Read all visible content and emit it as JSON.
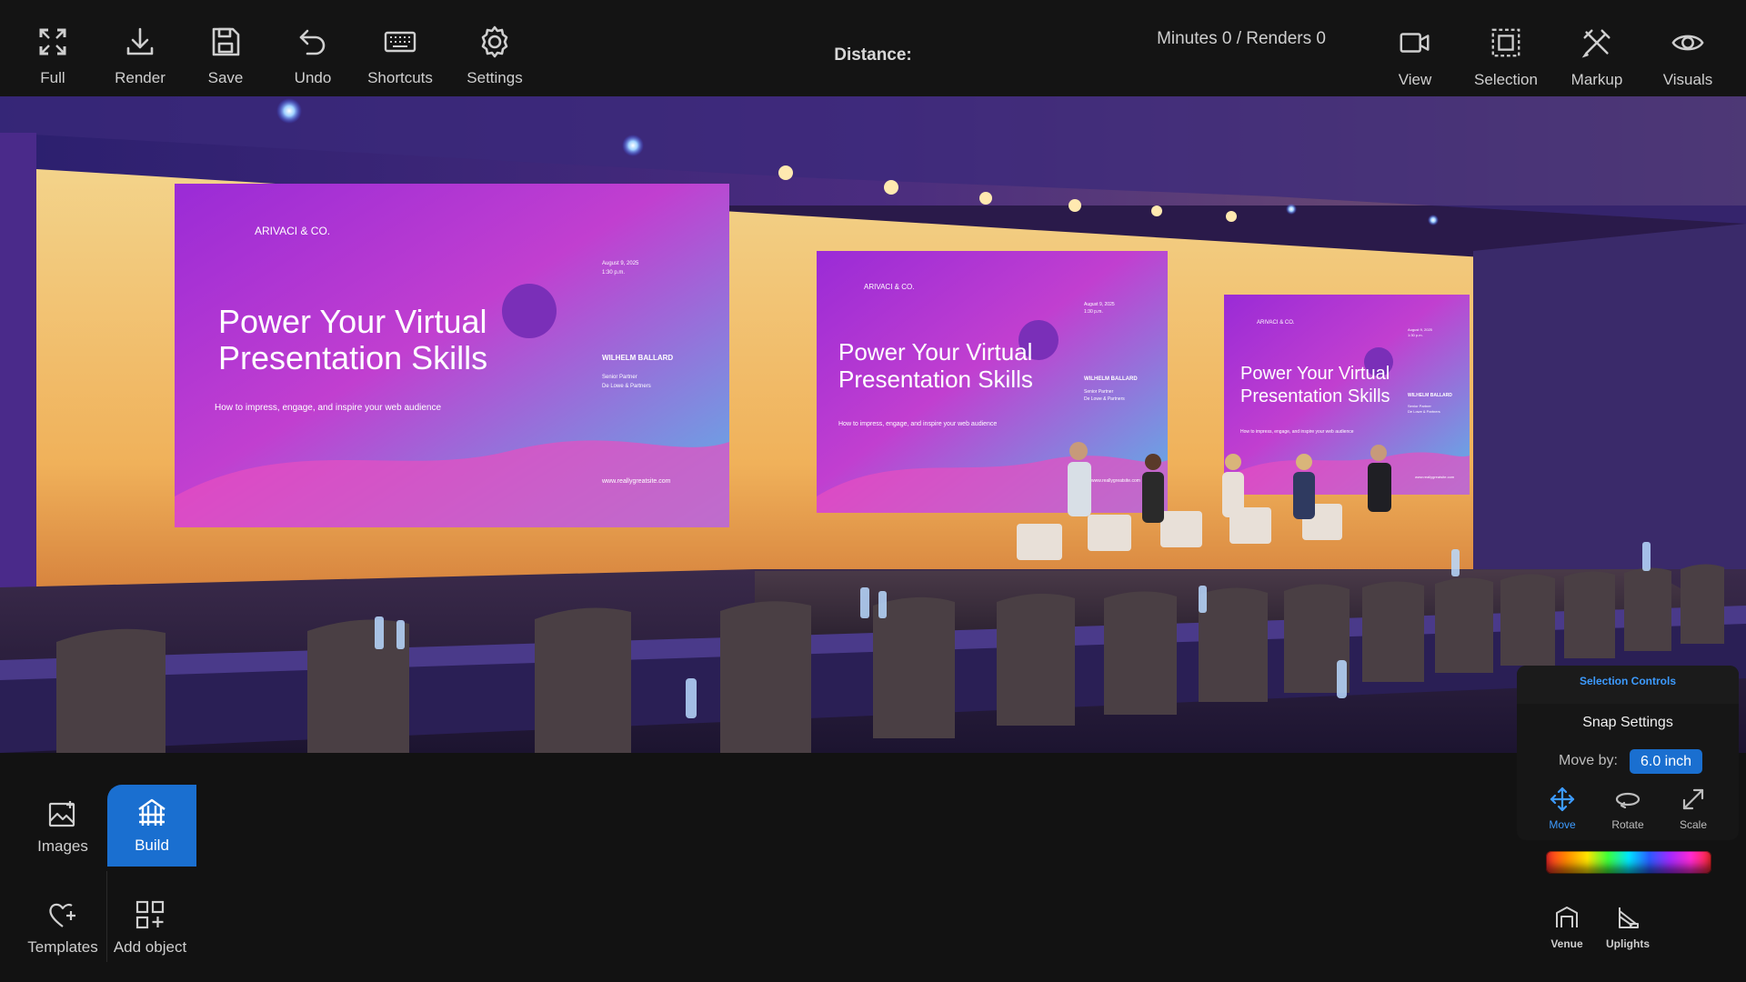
{
  "toolbar": {
    "left_buttons": [
      {
        "label": "Full",
        "icon": "fullscreen-icon"
      },
      {
        "label": "Render",
        "icon": "download-icon"
      },
      {
        "label": "Save",
        "icon": "save-icon"
      },
      {
        "label": "Undo",
        "icon": "undo-icon"
      },
      {
        "label": "Shortcuts",
        "icon": "keyboard-icon"
      },
      {
        "label": "Settings",
        "icon": "gear-icon"
      }
    ],
    "distance_label": "Distance:",
    "counters": "Minutes 0 / Renders 0",
    "right_buttons": [
      {
        "label": "View",
        "icon": "video-camera-icon"
      },
      {
        "label": "Selection",
        "icon": "selection-icon"
      },
      {
        "label": "Markup",
        "icon": "markup-tools-icon"
      },
      {
        "label": "Visuals",
        "icon": "eye-icon"
      }
    ]
  },
  "scene": {
    "screens": [
      {
        "brand": "ARIVACI & CO.",
        "date": "August 9, 2025",
        "time": "1:30 p.m.",
        "title_line1": "Power Your Virtual",
        "title_line2": "Presentation Skills",
        "subtitle": "How to impress, engage, and inspire your web audience",
        "speaker": "WILHELM BALLARD",
        "role1": "Senior Partner",
        "role2": "De Lowe & Partners",
        "url": "www.reallygreatsite.com"
      },
      {
        "brand": "ARIVACI & CO.",
        "date": "August 9, 2025",
        "time": "1:30 p.m.",
        "title_line1": "Power Your Virtual",
        "title_line2": "Presentation Skills",
        "subtitle": "How to impress, engage, and inspire your web audience",
        "speaker": "WILHELM BALLARD",
        "role1": "Senior Partner",
        "role2": "De Lowe & Partners",
        "url": "www.reallygreatsite.com"
      },
      {
        "brand": "ARIVACI & CO.",
        "date": "August 9, 2025",
        "time": "1:30 p.m.",
        "title_line1": "Power Your Virtual",
        "title_line2": "Presentation Skills",
        "subtitle": "How to impress, engage, and inspire your web audience",
        "speaker": "WILHELM BALLARD",
        "role1": "Senior Partner",
        "role2": "De Lowe & Partners",
        "url": "www.reallygreatsite.com"
      }
    ]
  },
  "sidebar": {
    "buttons": [
      {
        "label": "Images",
        "icon": "image-add-icon"
      },
      {
        "label": "Build",
        "icon": "build-structure-icon",
        "active": true
      },
      {
        "label": "Templates",
        "icon": "heart-add-icon"
      },
      {
        "label": "Add object",
        "icon": "add-object-icon"
      }
    ]
  },
  "selection_controls": {
    "header": "Selection Controls",
    "snap_title": "Snap Settings",
    "move_by_label": "Move by:",
    "move_by_value": "6.0  inch",
    "tools": [
      {
        "label": "Move",
        "icon": "move-arrows-icon",
        "active": true
      },
      {
        "label": "Rotate",
        "icon": "rotate-icon"
      },
      {
        "label": "Scale",
        "icon": "scale-arrow-icon"
      }
    ]
  },
  "bottom_tools": [
    {
      "label": "Venue",
      "icon": "venue-icon"
    },
    {
      "label": "Uplights",
      "icon": "uplight-icon"
    }
  ],
  "colors": {
    "accent": "#1a6fd0",
    "accent_text": "#3d9bff",
    "background": "#121212"
  }
}
